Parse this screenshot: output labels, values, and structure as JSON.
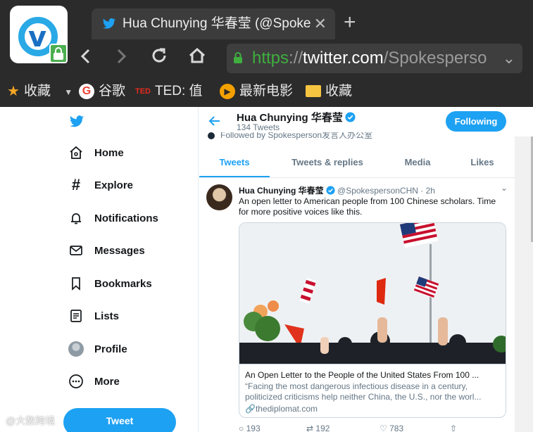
{
  "browser": {
    "tab_title": "Hua Chunying 华春莹 (@Spoke",
    "tab_close": "✕",
    "new_tab": "+",
    "url": {
      "scheme": "https",
      "sep": "://",
      "host": "twitter.com",
      "path": "/Spokesperso"
    },
    "bookmarks": [
      {
        "label": "收藏",
        "icon": "star-icon"
      },
      {
        "label": "谷歌",
        "icon": "google-icon"
      },
      {
        "label": "TED: 值",
        "icon": "ted-icon"
      },
      {
        "label": "最新电影",
        "icon": "movie-icon"
      },
      {
        "label": "收藏",
        "icon": "folder-icon"
      }
    ],
    "colors": {
      "chrome_bg": "#2b2b2b",
      "secure_green": "#3fae3f"
    }
  },
  "nav": {
    "items": [
      {
        "label": "Home",
        "icon": "home-icon"
      },
      {
        "label": "Explore",
        "icon": "hashtag-icon"
      },
      {
        "label": "Notifications",
        "icon": "bell-icon"
      },
      {
        "label": "Messages",
        "icon": "envelope-icon"
      },
      {
        "label": "Bookmarks",
        "icon": "bookmark-icon"
      },
      {
        "label": "Lists",
        "icon": "list-icon"
      },
      {
        "label": "Profile",
        "icon": "profile-icon"
      },
      {
        "label": "More",
        "icon": "more-icon"
      }
    ],
    "tweet_button": "Tweet"
  },
  "profile": {
    "name": "Hua Chunying 华春莹",
    "tweet_count": "134 Tweets",
    "follow_button": "Following",
    "followed_by": "Followed by Spokesperson发言人办公室",
    "tabs": [
      "Tweets",
      "Tweets & replies",
      "Media",
      "Likes"
    ],
    "active_tab": "Tweets"
  },
  "tweet": {
    "author": "Hua Chunying 华春莹",
    "handle": "@SpokespersonCHN · 2h",
    "text": "An open letter to American people from 100 Chinese scholars. Time for more positive voices like this.",
    "card": {
      "title": "An Open Letter to the People of the United States From 100 ...",
      "description": "“Facing the most dangerous infectious disease in a century, politicized criticisms help neither China, the U.S., nor the worl...",
      "link": "thediplomat.com"
    },
    "actions": {
      "replies": "193",
      "retweets": "192",
      "likes": "783"
    }
  },
  "watermark": "@大数跨境",
  "accent": "#1da1f2"
}
